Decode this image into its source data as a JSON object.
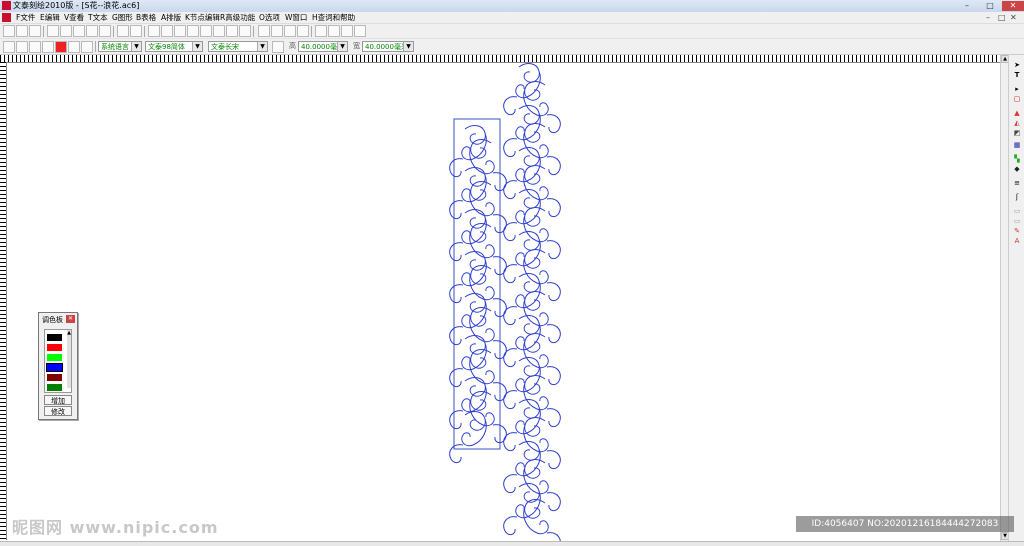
{
  "window": {
    "title": "文泰刻绘2010版 - [S花--浪花.ac6]",
    "min_label": "–",
    "max_label": "□",
    "close_label": "✕"
  },
  "menu": {
    "items": [
      "F文件",
      "E编辑",
      "V查看",
      "T文本",
      "G图形",
      "B表格",
      "A排版",
      "K节点编辑",
      "R高级功能",
      "O选项",
      "W窗口",
      "H查词和帮助"
    ]
  },
  "toolbar2": {
    "language": "系统语言",
    "font": "文泰98简体",
    "font_style": "文泰长宋",
    "height_label": "高",
    "height_value": "40.0000毫米",
    "width_label": "宽",
    "width_value": "40.0000毫米"
  },
  "palette": {
    "title": "调色板",
    "colors": [
      "#000000",
      "#ff0000",
      "#00ff00",
      "#0000ff",
      "#800000",
      "#008000"
    ],
    "add_label": "增加",
    "edit_label": "修改"
  },
  "watermark": {
    "left_text": "昵图网 www.nipic.com",
    "right_text": "ID:4056407 NO:20201216184444272083"
  },
  "colors": {
    "ornament": "#2f3fd0",
    "frame": "#3a4fc8"
  }
}
